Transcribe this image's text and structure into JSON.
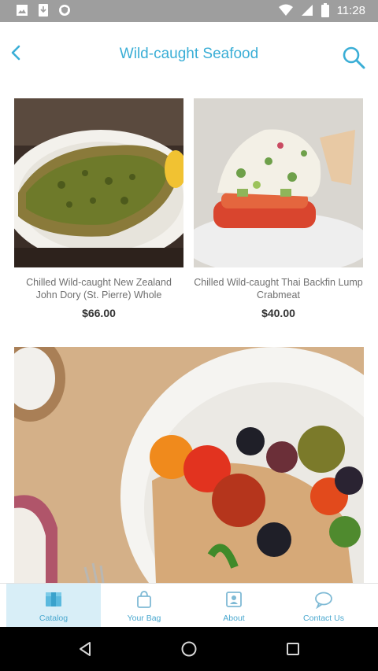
{
  "status_bar": {
    "time": "11:28",
    "icons": [
      "image-icon",
      "download-icon",
      "shield-icon",
      "wifi-icon",
      "signal-icon",
      "battery-icon"
    ]
  },
  "header": {
    "title": "Wild-caught Seafood",
    "back_icon": "chevron-left-icon",
    "search_icon": "search-icon"
  },
  "products": [
    {
      "name": "Chilled Wild-caught New Zealand John Dory (St. Pierre) Whole",
      "price": "$66.00"
    },
    {
      "name": "Chilled Wild-caught Thai Backfin Lump Crabmeat",
      "price": "$40.00"
    }
  ],
  "bottom_nav": {
    "items": [
      {
        "label": "Catalog",
        "icon": "catalog-icon",
        "active": true
      },
      {
        "label": "Your Bag",
        "icon": "bag-icon",
        "active": false
      },
      {
        "label": "About",
        "icon": "about-icon",
        "active": false
      },
      {
        "label": "Contact Us",
        "icon": "chat-icon",
        "active": false
      }
    ]
  },
  "colors": {
    "accent": "#3aaed6",
    "nav_active_bg": "#d8eef7",
    "status_bar": "#9e9e9e"
  }
}
